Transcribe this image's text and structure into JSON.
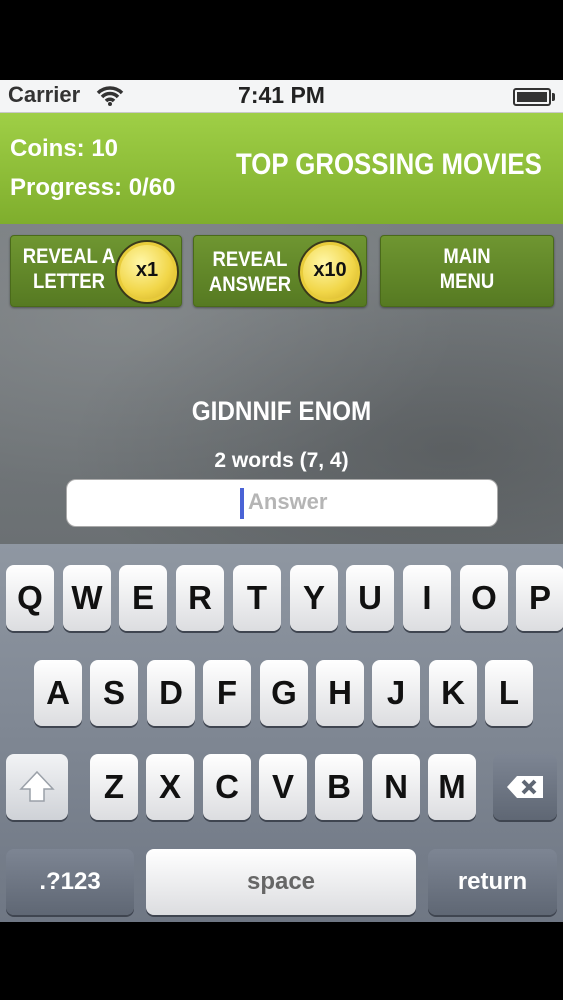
{
  "status": {
    "carrier": "Carrier",
    "time": "7:41 PM"
  },
  "header": {
    "coins": "Coins: 10",
    "progress": "Progress: 0/60",
    "category": "TOP GROSSING MOVIES"
  },
  "buttons": {
    "reveal_letter": {
      "label": "REVEAL A\nLETTER",
      "cost": "x1"
    },
    "reveal_answer": {
      "label": "REVEAL\nANSWER",
      "cost": "x10"
    },
    "main_menu": {
      "label": "MAIN\nMENU"
    }
  },
  "puzzle": {
    "scrambled": "GIDNNIF ENOM",
    "hint": "2 words (7, 4)"
  },
  "answer": {
    "placeholder": "Answer",
    "value": ""
  },
  "keyboard": {
    "row1": [
      "Q",
      "W",
      "E",
      "R",
      "T",
      "Y",
      "U",
      "I",
      "O",
      "P"
    ],
    "row2": [
      "A",
      "S",
      "D",
      "F",
      "G",
      "H",
      "J",
      "K",
      "L"
    ],
    "row3": [
      "Z",
      "X",
      "C",
      "V",
      "B",
      "N",
      "M"
    ],
    "numbers": ".?123",
    "space": "space",
    "return": "return"
  },
  "colors": {
    "header": "#8fc13a",
    "button": "#62892a",
    "coin": "#f1d648"
  },
  "icons": {
    "wifi": "wifi-icon",
    "battery": "battery-icon",
    "shift": "shift-arrow-icon",
    "backspace": "backspace-icon"
  }
}
